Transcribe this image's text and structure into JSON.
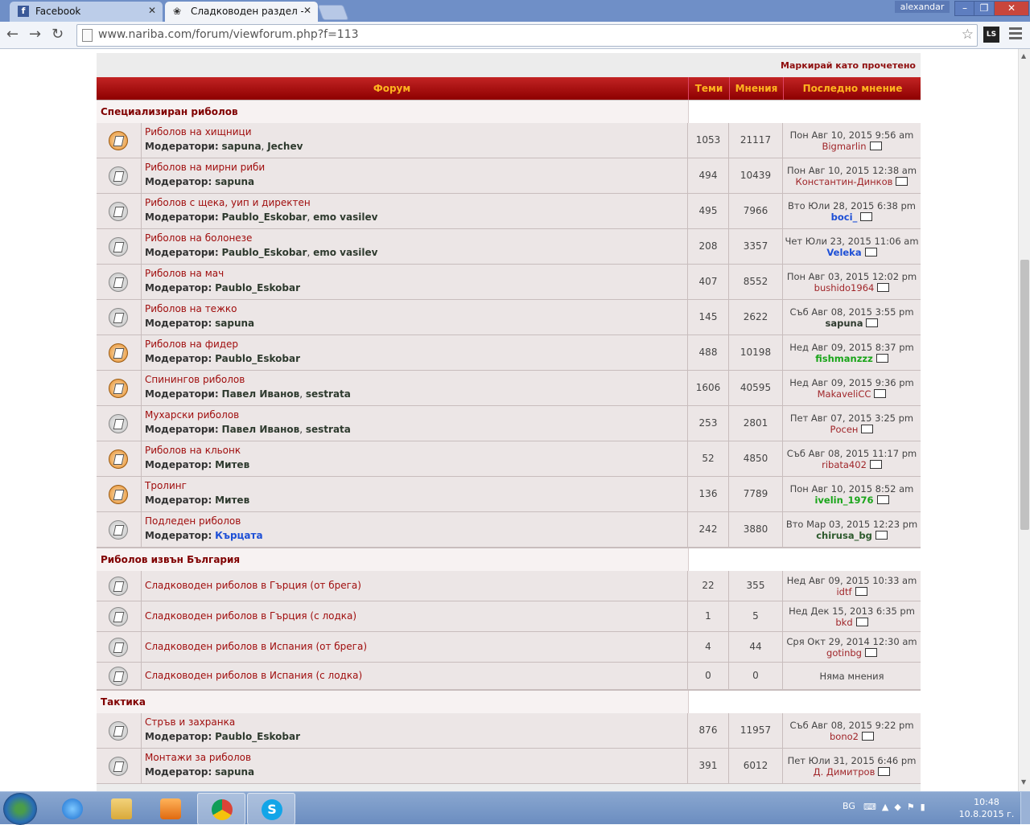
{
  "browser": {
    "tabs": [
      {
        "title": "Facebook",
        "icon": "facebook-icon"
      },
      {
        "title": "Сладководен раздел - na",
        "icon": "nariba-icon"
      }
    ],
    "user_badge": "alexandar",
    "url": "www.nariba.com/forum/viewforum.php?f=113",
    "extension_label": "LS",
    "window_controls": {
      "minimize": "–",
      "maximize": "❐",
      "close": "✕"
    }
  },
  "forum": {
    "mark_read": "Маркирай като прочетено",
    "headers": {
      "forum": "Форум",
      "topics": "Теми",
      "posts": "Мнения",
      "last_post": "Последно мнение"
    },
    "categories": [
      {
        "name": "Специализиран риболов",
        "rows": [
          {
            "title": "Риболов на хищници",
            "mods_label": "Модератори:",
            "mods": [
              "sapuna",
              "Jechev"
            ],
            "topics": "1053",
            "posts": "21117",
            "date": "Пон Авг 10, 2015 9:56 am",
            "user": "Bigmarlin",
            "user_style": "normal",
            "icon": "new"
          },
          {
            "title": "Риболов на мирни риби",
            "mods_label": "Модератор:",
            "mods": [
              "sapuna"
            ],
            "topics": "494",
            "posts": "10439",
            "date": "Пон Авг 10, 2015 12:38 am",
            "user": "Константин-Динков",
            "user_style": "normal",
            "icon": "old"
          },
          {
            "title": "Риболов с щека, уип и директен",
            "mods_label": "Модератори:",
            "mods": [
              "Paublo_Eskobar",
              "emo vasilev"
            ],
            "topics": "495",
            "posts": "7966",
            "date": "Вто Юли 28, 2015 6:38 pm",
            "user": "boci_",
            "user_style": "blue",
            "icon": "old"
          },
          {
            "title": "Риболов на болонезе",
            "mods_label": "Модератори:",
            "mods": [
              "Paublo_Eskobar",
              "emo vasilev"
            ],
            "topics": "208",
            "posts": "3357",
            "date": "Чет Юли 23, 2015 11:06 am",
            "user": "Veleka",
            "user_style": "blue",
            "icon": "old"
          },
          {
            "title": "Риболов на мач",
            "mods_label": "Модератор:",
            "mods": [
              "Paublo_Eskobar"
            ],
            "topics": "407",
            "posts": "8552",
            "date": "Пон Авг 03, 2015 12:02 pm",
            "user": "bushido1964",
            "user_style": "normal",
            "icon": "old"
          },
          {
            "title": "Риболов на тежко",
            "mods_label": "Модератор:",
            "mods": [
              "sapuna"
            ],
            "topics": "145",
            "posts": "2622",
            "date": "Съб Авг 08, 2015 3:55 pm",
            "user": "sapuna",
            "user_style": "dark",
            "icon": "old"
          },
          {
            "title": "Риболов на фидер",
            "mods_label": "Модератор:",
            "mods": [
              "Paublo_Eskobar"
            ],
            "topics": "488",
            "posts": "10198",
            "date": "Нед Авг 09, 2015 8:37 pm",
            "user": "fishmanzzz",
            "user_style": "green",
            "icon": "new"
          },
          {
            "title": "Спинингов риболов",
            "mods_label": "Модератори:",
            "mods": [
              "Павел Иванов",
              "sestrata"
            ],
            "topics": "1606",
            "posts": "40595",
            "date": "Нед Авг 09, 2015 9:36 pm",
            "user": "MakaveliCC",
            "user_style": "normal",
            "icon": "new"
          },
          {
            "title": "Мухарски риболов",
            "mods_label": "Модератори:",
            "mods": [
              "Павел Иванов",
              "sestrata"
            ],
            "topics": "253",
            "posts": "2801",
            "date": "Пет Авг 07, 2015 3:25 pm",
            "user": "Росен",
            "user_style": "normal",
            "icon": "old"
          },
          {
            "title": "Риболов на кльонк",
            "mods_label": "Модератор:",
            "mods": [
              "Митев"
            ],
            "topics": "52",
            "posts": "4850",
            "date": "Съб Авг 08, 2015 11:17 pm",
            "user": "ribata402",
            "user_style": "normal",
            "icon": "new"
          },
          {
            "title": "Тролинг",
            "mods_label": "Модератор:",
            "mods": [
              "Митев"
            ],
            "topics": "136",
            "posts": "7789",
            "date": "Пон Авг 10, 2015 8:52 am",
            "user": "ivelin_1976",
            "user_style": "green",
            "icon": "new"
          },
          {
            "title": "Подледен риболов",
            "mods_label": "Модератор:",
            "mods": [
              "Кърцата"
            ],
            "mods_style": "blue",
            "topics": "242",
            "posts": "3880",
            "date": "Вто Мар 03, 2015 12:23 pm",
            "user": "chirusa_bg",
            "user_style": "darkgreen",
            "icon": "old"
          }
        ]
      },
      {
        "name": "Риболов извън България",
        "rows": [
          {
            "title": "Сладководен риболов в Гърция (от брега)",
            "topics": "22",
            "posts": "355",
            "date": "Нед Авг 09, 2015 10:33 am",
            "user": "idtf",
            "user_style": "normal",
            "icon": "old"
          },
          {
            "title": "Сладководен риболов в Гърция (с лодка)",
            "topics": "1",
            "posts": "5",
            "date": "Нед Дек 15, 2013 6:35 pm",
            "user": "bkd",
            "user_style": "normal",
            "icon": "old"
          },
          {
            "title": "Сладководен риболов в Испания (от брега)",
            "topics": "4",
            "posts": "44",
            "date": "Сря Окт 29, 2014 12:30 am",
            "user": "gotinbg",
            "user_style": "normal",
            "icon": "old"
          },
          {
            "title": "Сладководен риболов в Испания (с лодка)",
            "topics": "0",
            "posts": "0",
            "no_posts": "Няма мнения",
            "icon": "old"
          }
        ]
      },
      {
        "name": "Тактика",
        "rows": [
          {
            "title": "Стръв и захранка",
            "mods_label": "Модератор:",
            "mods": [
              "Paublo_Eskobar"
            ],
            "topics": "876",
            "posts": "11957",
            "date": "Съб Авг 08, 2015 9:22 pm",
            "user": "bono2",
            "user_style": "normal",
            "icon": "old"
          },
          {
            "title": "Монтажи за риболов",
            "mods_label": "Модератор:",
            "mods": [
              "sapuna"
            ],
            "topics": "391",
            "posts": "6012",
            "date": "Пет Юли 31, 2015 6:46 pm",
            "user": "Д. Димитров",
            "user_style": "normal",
            "icon": "old",
            "annotated": true
          }
        ]
      }
    ]
  },
  "taskbar": {
    "apps": [
      "internet-explorer-icon",
      "file-explorer-icon",
      "media-player-icon",
      "chrome-icon",
      "skype-icon"
    ],
    "language": "BG",
    "time": "10:48",
    "date": "10.8.2015 г."
  },
  "colors": {
    "header_red": "#a50d0d",
    "header_text": "#ffb41f",
    "link": "#a00e0e",
    "annotation": "#e4121a"
  }
}
